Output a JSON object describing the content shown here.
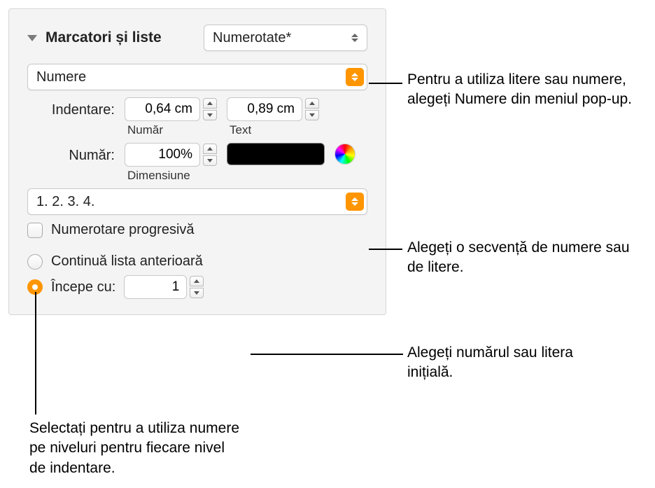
{
  "header": {
    "title": "Marcatori și liste",
    "style_dropdown": "Numerotate*"
  },
  "bullets_type_dropdown": "Numere",
  "indent": {
    "label": "Indentare:",
    "number_value": "0,64 cm",
    "number_sublabel": "Număr",
    "text_value": "0,89 cm",
    "text_sublabel": "Text"
  },
  "number": {
    "label": "Număr:",
    "size_value": "100%",
    "size_sublabel": "Dimensiune",
    "color": "#000000"
  },
  "sequence_dropdown": "1. 2. 3. 4.",
  "tiered_checkbox_label": "Numerotare progresivă",
  "continue_radio_label": "Continuă lista anterioară",
  "start_radio_label": "Începe cu:",
  "start_value": "1",
  "callouts": {
    "c1": "Pentru a utiliza litere sau numere, alegeți Numere din meniul pop-up.",
    "c2": "Alegeți o secvență de numere sau de litere.",
    "c3": "Alegeți numărul sau litera inițială.",
    "c4": "Selectați pentru a utiliza numere pe niveluri pentru fiecare nivel de indentare."
  }
}
